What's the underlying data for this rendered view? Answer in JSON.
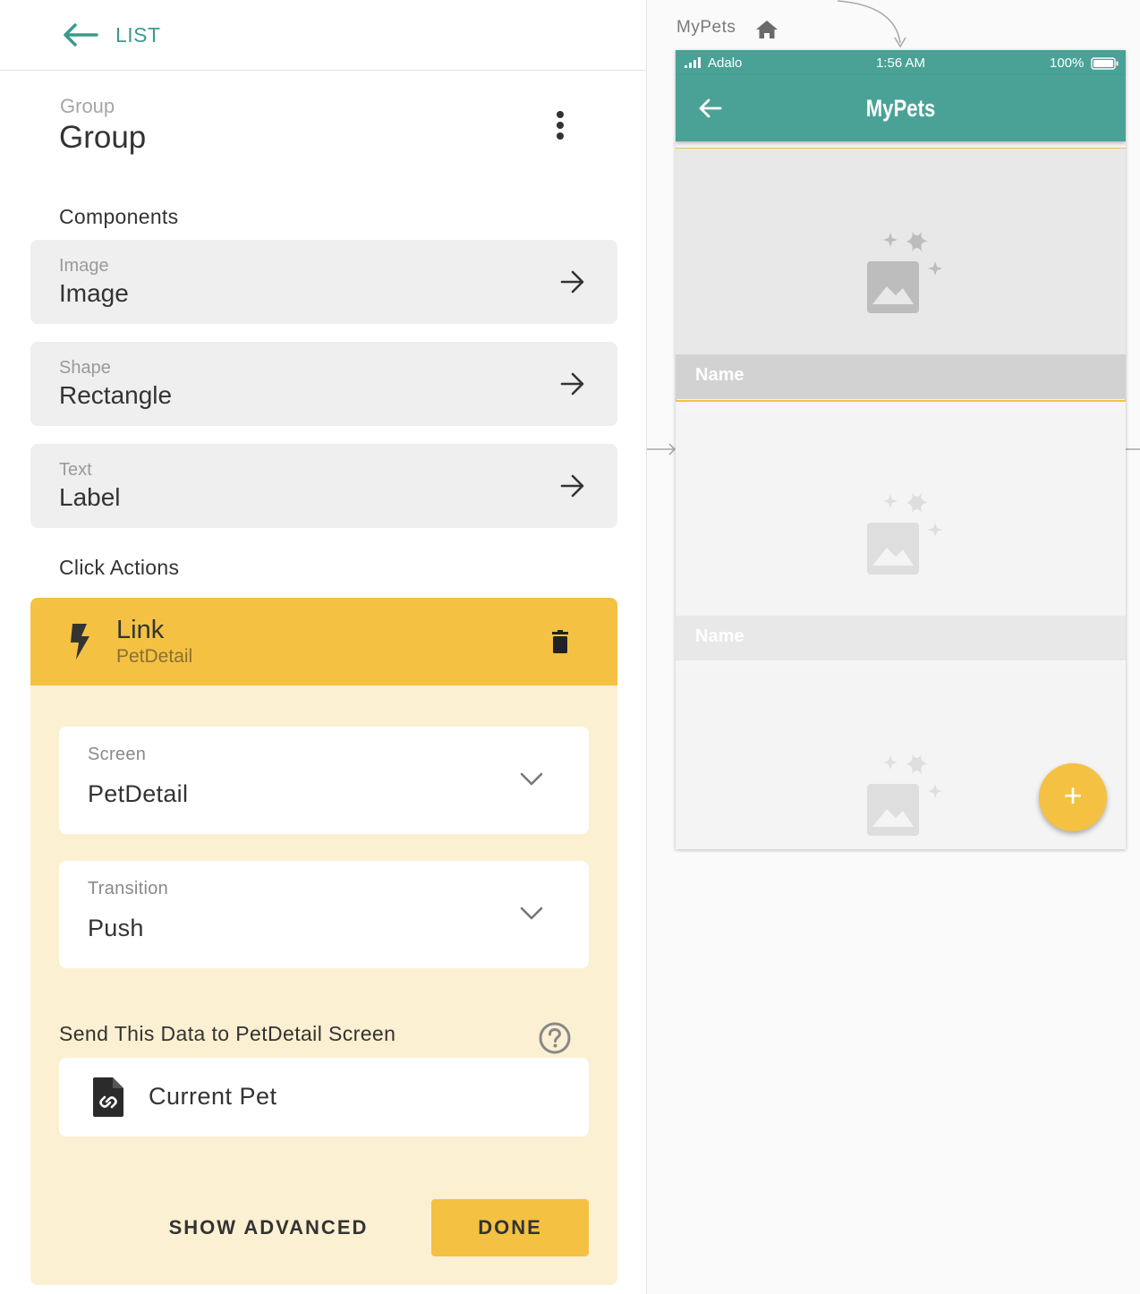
{
  "panel": {
    "back_label": "LIST",
    "group_kind": "Group",
    "group_name": "Group",
    "components_heading": "Components",
    "components": [
      {
        "kind": "Image",
        "name": "Image"
      },
      {
        "kind": "Shape",
        "name": "Rectangle"
      },
      {
        "kind": "Text",
        "name": "Label"
      }
    ],
    "click_actions_heading": "Click Actions",
    "action": {
      "type": "Link",
      "target": "PetDetail",
      "screen_label": "Screen",
      "screen_value": "PetDetail",
      "transition_label": "Transition",
      "transition_value": "Push",
      "send_data_label": "Send This Data to PetDetail Screen",
      "data_value": "Current Pet",
      "show_advanced_label": "SHOW ADVANCED",
      "done_label": "DONE"
    }
  },
  "canvas": {
    "screen_name": "MyPets",
    "phone": {
      "carrier": "Adalo",
      "time": "1:56 AM",
      "battery": "100%",
      "title": "MyPets",
      "items": [
        {
          "name": "Name",
          "selected": true
        },
        {
          "name": "Name",
          "selected": false
        },
        {
          "name": "",
          "selected": false
        }
      ],
      "fab_symbol": "+"
    }
  },
  "colors": {
    "accent_teal": "#4aa296",
    "accent_yellow": "#f4c142",
    "action_body": "#fcf0d2"
  }
}
